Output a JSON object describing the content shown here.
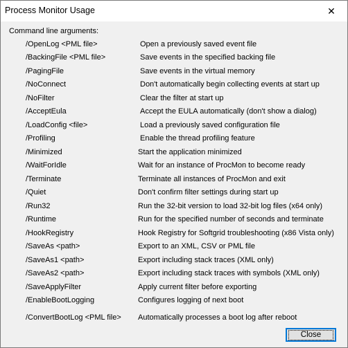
{
  "window": {
    "title": "Process Monitor Usage",
    "close_glyph": "✕"
  },
  "heading": "Command line arguments:",
  "arguments": [
    {
      "name": "/OpenLog <PML file>",
      "desc": "Open a previously saved event file"
    },
    {
      "name": "/BackingFile <PML file>",
      "desc": "Save events in the specified backing file"
    },
    {
      "name": "/PagingFile",
      "desc": "Save events in the virtual memory"
    },
    {
      "name": "/NoConnect",
      "desc": "Don't automatically begin collecting events at start up"
    },
    {
      "name": "/NoFilter",
      "desc": "Clear the filter at start up"
    },
    {
      "name": "/AcceptEula",
      "desc": "Accept the EULA automatically (don't show a dialog)"
    },
    {
      "name": "/LoadConfig <file>",
      "desc": "Load a previously saved configuration file"
    },
    {
      "name": "/Profiling",
      "desc": "Enable the thread profiling feature"
    },
    {
      "name": "/Minimized",
      "desc": "Start the application minimized"
    },
    {
      "name": "/WaitForIdle",
      "desc": "Wait for an instance of ProcMon to become ready"
    },
    {
      "name": "/Terminate",
      "desc": "Terminate all instances of ProcMon and exit"
    },
    {
      "name": "/Quiet",
      "desc": "Don't confirm filter settings during start up"
    },
    {
      "name": "/Run32",
      "desc": "Run the 32-bit version to load 32-bit log files (x64 only)"
    },
    {
      "name": "/Runtime",
      "desc": "Run for the specified number of seconds and terminate"
    },
    {
      "name": "/HookRegistry",
      "desc": "Hook Registry for Softgrid troubleshooting (x86 Vista only)"
    },
    {
      "name": "/SaveAs <path>",
      "desc": "Export to an XML, CSV or PML file"
    },
    {
      "name": "/SaveAs1 <path>",
      "desc": "Export including stack traces (XML only)"
    },
    {
      "name": "/SaveAs2 <path>",
      "desc": "Export including stack traces with symbols (XML only)"
    },
    {
      "name": "/SaveApplyFilter",
      "desc": "Apply current filter before exporting"
    },
    {
      "name": "/EnableBootLogging",
      "desc": "Configures logging of next boot"
    },
    {
      "name": "/ConvertBootLog <PML file>",
      "desc": "Automatically processes a boot log after reboot"
    }
  ],
  "buttons": {
    "close_label": "Close"
  }
}
